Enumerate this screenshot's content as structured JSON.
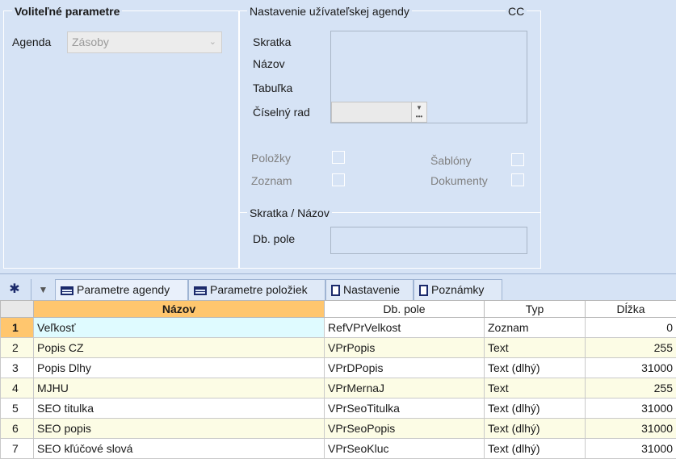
{
  "optional_params": {
    "title": "Voliteľné parametre",
    "agenda_label": "Agenda",
    "agenda_value": "Zásoby"
  },
  "user_agenda": {
    "title": "Nastavenie užívateľskej agendy",
    "cc": "CC",
    "skratka_label": "Skratka",
    "nazov_label": "Názov",
    "tabulka_label": "Tabuľka",
    "ciselny_rad_label": "Číselný rad",
    "polozky_label": "Položky",
    "zoznam_label": "Zoznam",
    "sablony_label": "Šablóny",
    "dokumenty_label": "Dokumenty"
  },
  "skratka_nazov": {
    "title": "Skratka / Názov",
    "db_pole_label": "Db. pole"
  },
  "tabs": [
    {
      "label": "Parametre agendy",
      "icon": "table-icon",
      "active": true
    },
    {
      "label": "Parametre položiek",
      "icon": "table-icon",
      "active": false
    },
    {
      "label": "Nastavenie",
      "icon": "document-icon",
      "active": false
    },
    {
      "label": "Poznámky",
      "icon": "document-icon",
      "active": false
    }
  ],
  "grid": {
    "columns": [
      "Názov",
      "Db. pole",
      "Typ",
      "Dĺžka"
    ],
    "rows": [
      {
        "n": "1",
        "nazov": "Veľkosť",
        "db": "RefVPrVelkost",
        "typ": "Zoznam",
        "dlzka": "0"
      },
      {
        "n": "2",
        "nazov": "Popis CZ",
        "db": "VPrPopis",
        "typ": "Text",
        "dlzka": "255"
      },
      {
        "n": "3",
        "nazov": "Popis Dlhy",
        "db": "VPrDPopis",
        "typ": "Text (dlhý)",
        "dlzka": "31000"
      },
      {
        "n": "4",
        "nazov": "MJHU",
        "db": "VPrMernaJ",
        "typ": "Text",
        "dlzka": "255"
      },
      {
        "n": "5",
        "nazov": "SEO titulka",
        "db": "VPrSeoTitulka",
        "typ": "Text (dlhý)",
        "dlzka": "31000"
      },
      {
        "n": "6",
        "nazov": "SEO popis",
        "db": "VPrSeoPopis",
        "typ": "Text (dlhý)",
        "dlzka": "31000"
      },
      {
        "n": "7",
        "nazov": "SEO kľúčové slová",
        "db": "VPrSeoKluc",
        "typ": "Text (dlhý)",
        "dlzka": "31000"
      }
    ]
  },
  "colors": {
    "background": "#d6e3f5",
    "sorted_header": "#ffc66e",
    "alt_row": "#fcfce5",
    "selected_cell": "#dffbff"
  }
}
